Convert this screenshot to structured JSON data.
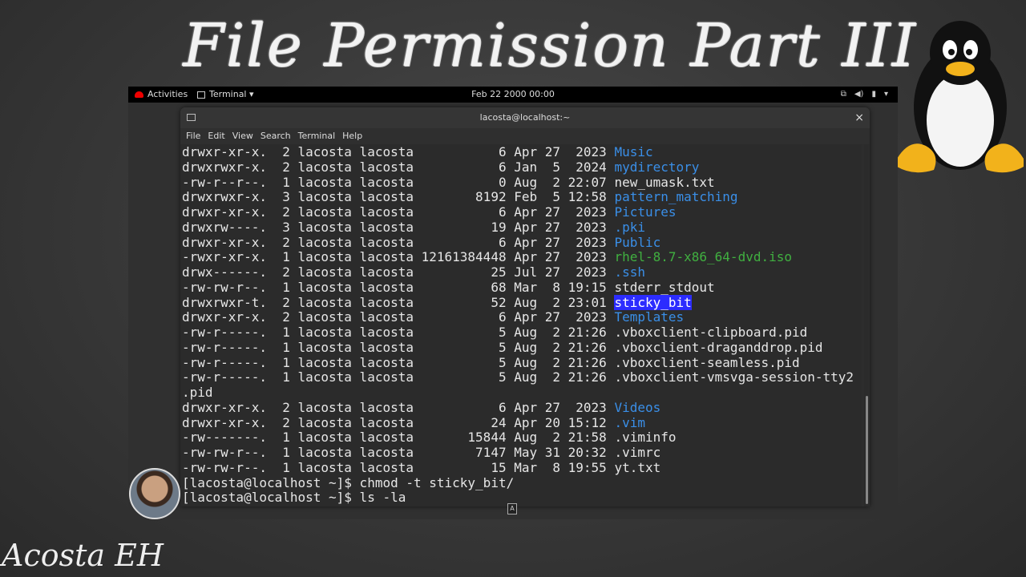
{
  "overlay": {
    "title": "File Permission Part III",
    "signature": "Acosta EH"
  },
  "topbar": {
    "activities": "Activities",
    "app_menu": "Terminal ▾",
    "clock": "Feb 22 2000 00:00",
    "tray_icons": [
      "network-icon",
      "volume-icon",
      "battery-icon",
      "chevron-down-icon"
    ]
  },
  "window": {
    "title": "lacosta@localhost:~",
    "close": "×",
    "menu": [
      "File",
      "Edit",
      "View",
      "Search",
      "Terminal",
      "Help"
    ]
  },
  "terminal": {
    "lines": [
      {
        "pre": "drwxr-xr-x.  2 lacosta lacosta           6 Apr 27  2023 ",
        "name": "Music",
        "style": "blue"
      },
      {
        "pre": "drwxrwxr-x.  2 lacosta lacosta           6 Jan  5  2024 ",
        "name": "mydirectory",
        "style": "blue"
      },
      {
        "pre": "-rw-r--r--.  1 lacosta lacosta           0 Aug  2 22:07 ",
        "name": "new_umask.txt",
        "style": ""
      },
      {
        "pre": "drwxrwxr-x.  3 lacosta lacosta        8192 Feb  5 12:58 ",
        "name": "pattern_matching",
        "style": "blue"
      },
      {
        "pre": "drwxr-xr-x.  2 lacosta lacosta           6 Apr 27  2023 ",
        "name": "Pictures",
        "style": "blue"
      },
      {
        "pre": "drwxrw----.  3 lacosta lacosta          19 Apr 27  2023 ",
        "name": ".pki",
        "style": "blue"
      },
      {
        "pre": "drwxr-xr-x.  2 lacosta lacosta           6 Apr 27  2023 ",
        "name": "Public",
        "style": "blue"
      },
      {
        "pre": "-rwxr-xr-x.  1 lacosta lacosta 12161384448 Apr 27  2023 ",
        "name": "rhel-8.7-x86_64-dvd.iso",
        "style": "green"
      },
      {
        "pre": "drwx------.  2 lacosta lacosta          25 Jul 27  2023 ",
        "name": ".ssh",
        "style": "blue"
      },
      {
        "pre": "-rw-rw-r--.  1 lacosta lacosta          68 Mar  8 19:15 ",
        "name": "stderr_stdout",
        "style": ""
      },
      {
        "pre": "drwxrwxr-t.  2 lacosta lacosta          52 Aug  2 23:01 ",
        "name": "sticky_bit",
        "style": "hl"
      },
      {
        "pre": "drwxr-xr-x.  2 lacosta lacosta           6 Apr 27  2023 ",
        "name": "Templates",
        "style": "blue"
      },
      {
        "pre": "-rw-r-----.  1 lacosta lacosta           5 Aug  2 21:26 ",
        "name": ".vboxclient-clipboard.pid",
        "style": ""
      },
      {
        "pre": "-rw-r-----.  1 lacosta lacosta           5 Aug  2 21:26 ",
        "name": ".vboxclient-draganddrop.pid",
        "style": ""
      },
      {
        "pre": "-rw-r-----.  1 lacosta lacosta           5 Aug  2 21:26 ",
        "name": ".vboxclient-seamless.pid",
        "style": ""
      },
      {
        "pre": "-rw-r-----.  1 lacosta lacosta           5 Aug  2 21:26 ",
        "name": ".vboxclient-vmsvga-session-tty2",
        "style": ""
      },
      {
        "pre": ".pid",
        "name": "",
        "style": ""
      },
      {
        "pre": "drwxr-xr-x.  2 lacosta lacosta           6 Apr 27  2023 ",
        "name": "Videos",
        "style": "blue"
      },
      {
        "pre": "drwxr-xr-x.  2 lacosta lacosta          24 Apr 20 15:12 ",
        "name": ".vim",
        "style": "blue"
      },
      {
        "pre": "-rw-------.  1 lacosta lacosta       15844 Aug  2 21:58 ",
        "name": ".viminfo",
        "style": ""
      },
      {
        "pre": "-rw-rw-r--.  1 lacosta lacosta        7147 May 31 20:32 ",
        "name": ".vimrc",
        "style": ""
      },
      {
        "pre": "-rw-rw-r--.  1 lacosta lacosta          15 Mar  8 19:55 ",
        "name": "yt.txt",
        "style": ""
      },
      {
        "pre": "[lacosta@localhost ~]$ chmod -t sticky_bit/",
        "name": "",
        "style": ""
      },
      {
        "pre": "[lacosta@localhost ~]$ ls -la",
        "name": "",
        "style": ""
      }
    ]
  },
  "cursor_hint": "A"
}
